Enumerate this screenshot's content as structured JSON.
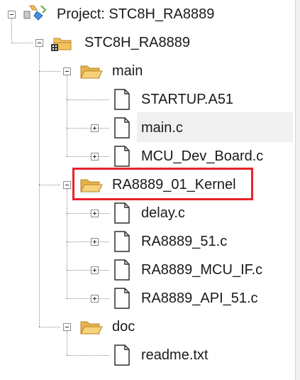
{
  "tree": {
    "root": {
      "label": "Project: STC8H_RA8889",
      "expanded": true,
      "icon": "project-icon"
    },
    "target": {
      "label": "STC8H_RA8889",
      "expanded": true,
      "icon": "target-folder-icon"
    },
    "groups": [
      {
        "label": "main",
        "expanded": true,
        "files": [
          {
            "label": "STARTUP.A51",
            "expandable": false
          },
          {
            "label": "main.c",
            "expandable": true,
            "selected": true
          },
          {
            "label": "MCU_Dev_Board.c",
            "expandable": true
          }
        ]
      },
      {
        "label": "RA8889_01_Kernel",
        "expanded": true,
        "highlighted": true,
        "files": [
          {
            "label": "delay.c",
            "expandable": true
          },
          {
            "label": "RA8889_51.c",
            "expandable": true
          },
          {
            "label": "RA8889_MCU_IF.c",
            "expandable": true
          },
          {
            "label": "RA8889_API_51.c",
            "expandable": true
          }
        ]
      },
      {
        "label": "doc",
        "expanded": true,
        "files": [
          {
            "label": "readme.txt",
            "expandable": false
          }
        ]
      }
    ]
  },
  "colors": {
    "highlight_border": "#e8232a",
    "folder_fill": "#f3c35c",
    "folder_edge": "#b8862b"
  }
}
